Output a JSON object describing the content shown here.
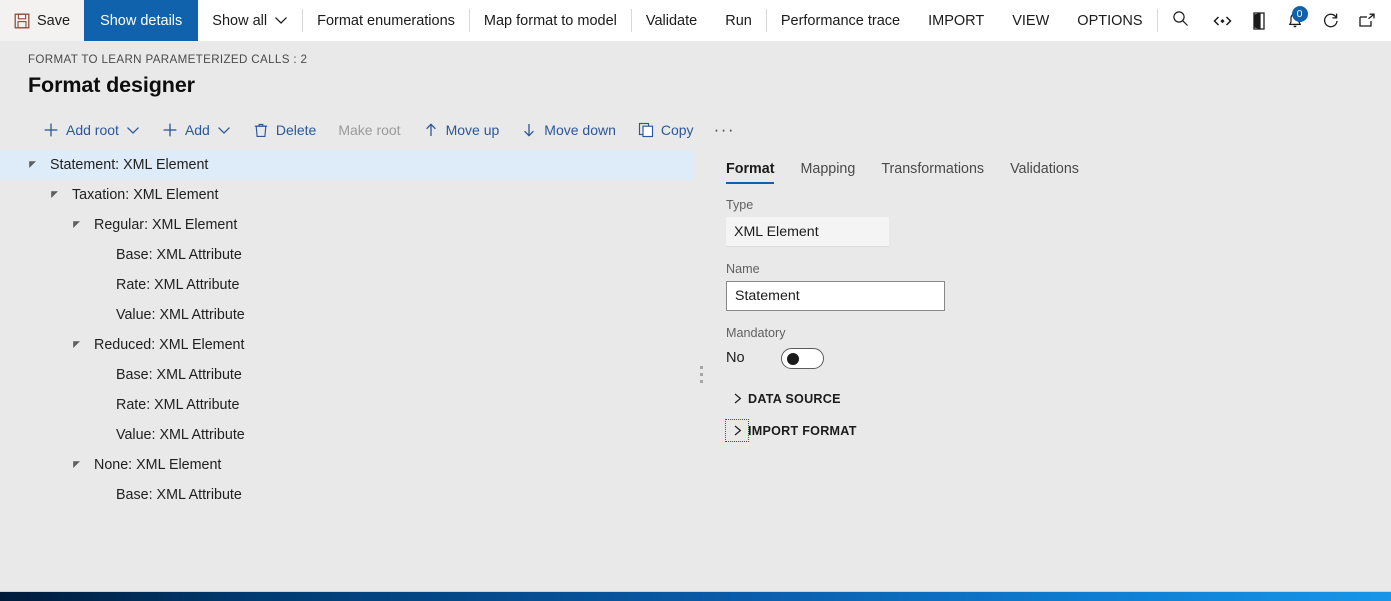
{
  "topbar": {
    "items": [
      {
        "label": "Save",
        "icon": "save-icon",
        "kind": "save"
      },
      {
        "label": "Show details",
        "kind": "primary"
      },
      {
        "label": "Show all",
        "kind": "dropdown"
      },
      {
        "label": "Format enumerations",
        "kind": "plain",
        "sep_before": true
      },
      {
        "label": "Map format to model",
        "kind": "plain",
        "sep_before": true
      },
      {
        "label": "Validate",
        "kind": "plain",
        "sep_before": true
      },
      {
        "label": "Run",
        "kind": "plain"
      },
      {
        "label": "Performance trace",
        "kind": "plain",
        "sep_before": true
      },
      {
        "label": "IMPORT",
        "kind": "plain"
      },
      {
        "label": "VIEW",
        "kind": "plain"
      },
      {
        "label": "OPTIONS",
        "kind": "plain"
      }
    ],
    "search_icon": "search-icon",
    "right_icons": [
      {
        "name": "feedback-icon",
        "badge": null
      },
      {
        "name": "company-icon",
        "badge": null
      },
      {
        "name": "notifications-icon",
        "badge": "0"
      },
      {
        "name": "refresh-icon",
        "badge": null
      },
      {
        "name": "popout-icon",
        "badge": null
      },
      {
        "name": "close-icon",
        "badge": null
      }
    ]
  },
  "header": {
    "breadcrumb": "FORMAT TO LEARN PARAMETERIZED CALLS : 2",
    "title": "Format designer"
  },
  "actionbar": {
    "actions": [
      {
        "label": "Add root",
        "icon": "plus-icon",
        "caret": true,
        "disabled": false
      },
      {
        "label": "Add",
        "icon": "plus-icon",
        "caret": true,
        "disabled": false
      },
      {
        "label": "Delete",
        "icon": "trash-icon",
        "caret": false,
        "disabled": false
      },
      {
        "label": "Make root",
        "icon": null,
        "caret": false,
        "disabled": true
      },
      {
        "label": "Move up",
        "icon": "arrow-up-icon",
        "caret": false,
        "disabled": false
      },
      {
        "label": "Move down",
        "icon": "arrow-down-icon",
        "caret": false,
        "disabled": false
      },
      {
        "label": "Copy",
        "icon": "copy-icon",
        "caret": false,
        "disabled": false
      }
    ],
    "overflow_label": "···"
  },
  "tree": {
    "nodes": [
      {
        "label": "Statement: XML Element",
        "level": 0,
        "expander": true,
        "selected": true
      },
      {
        "label": "Taxation: XML Element",
        "level": 1,
        "expander": true,
        "selected": false
      },
      {
        "label": "Regular: XML Element",
        "level": 2,
        "expander": true,
        "selected": false
      },
      {
        "label": "Base: XML Attribute",
        "level": 3,
        "expander": false,
        "selected": false
      },
      {
        "label": "Rate: XML Attribute",
        "level": 3,
        "expander": false,
        "selected": false
      },
      {
        "label": "Value: XML Attribute",
        "level": 3,
        "expander": false,
        "selected": false
      },
      {
        "label": "Reduced: XML Element",
        "level": 2,
        "expander": true,
        "selected": false
      },
      {
        "label": "Base: XML Attribute",
        "level": 3,
        "expander": false,
        "selected": false
      },
      {
        "label": "Rate: XML Attribute",
        "level": 3,
        "expander": false,
        "selected": false
      },
      {
        "label": "Value: XML Attribute",
        "level": 3,
        "expander": false,
        "selected": false
      },
      {
        "label": "None: XML Element",
        "level": 2,
        "expander": true,
        "selected": false
      },
      {
        "label": "Base: XML Attribute",
        "level": 3,
        "expander": false,
        "selected": false
      }
    ]
  },
  "detail": {
    "tabs": [
      {
        "label": "Format",
        "active": true
      },
      {
        "label": "Mapping",
        "active": false
      },
      {
        "label": "Transformations",
        "active": false
      },
      {
        "label": "Validations",
        "active": false
      }
    ],
    "type_label": "Type",
    "type_value": "XML Element",
    "name_label": "Name",
    "name_value": "Statement",
    "name_placeholder": "",
    "mandatory_label": "Mandatory",
    "mandatory_value": "No",
    "sections": [
      {
        "title": "DATA SOURCE",
        "expanded": false,
        "focused": false
      },
      {
        "title": "IMPORT FORMAT",
        "expanded": false,
        "focused": true
      }
    ]
  },
  "colors": {
    "accent": "#0f62ab",
    "selection": "#deecf9",
    "page_bg": "#e9e9e9",
    "link": "#2b579a"
  }
}
